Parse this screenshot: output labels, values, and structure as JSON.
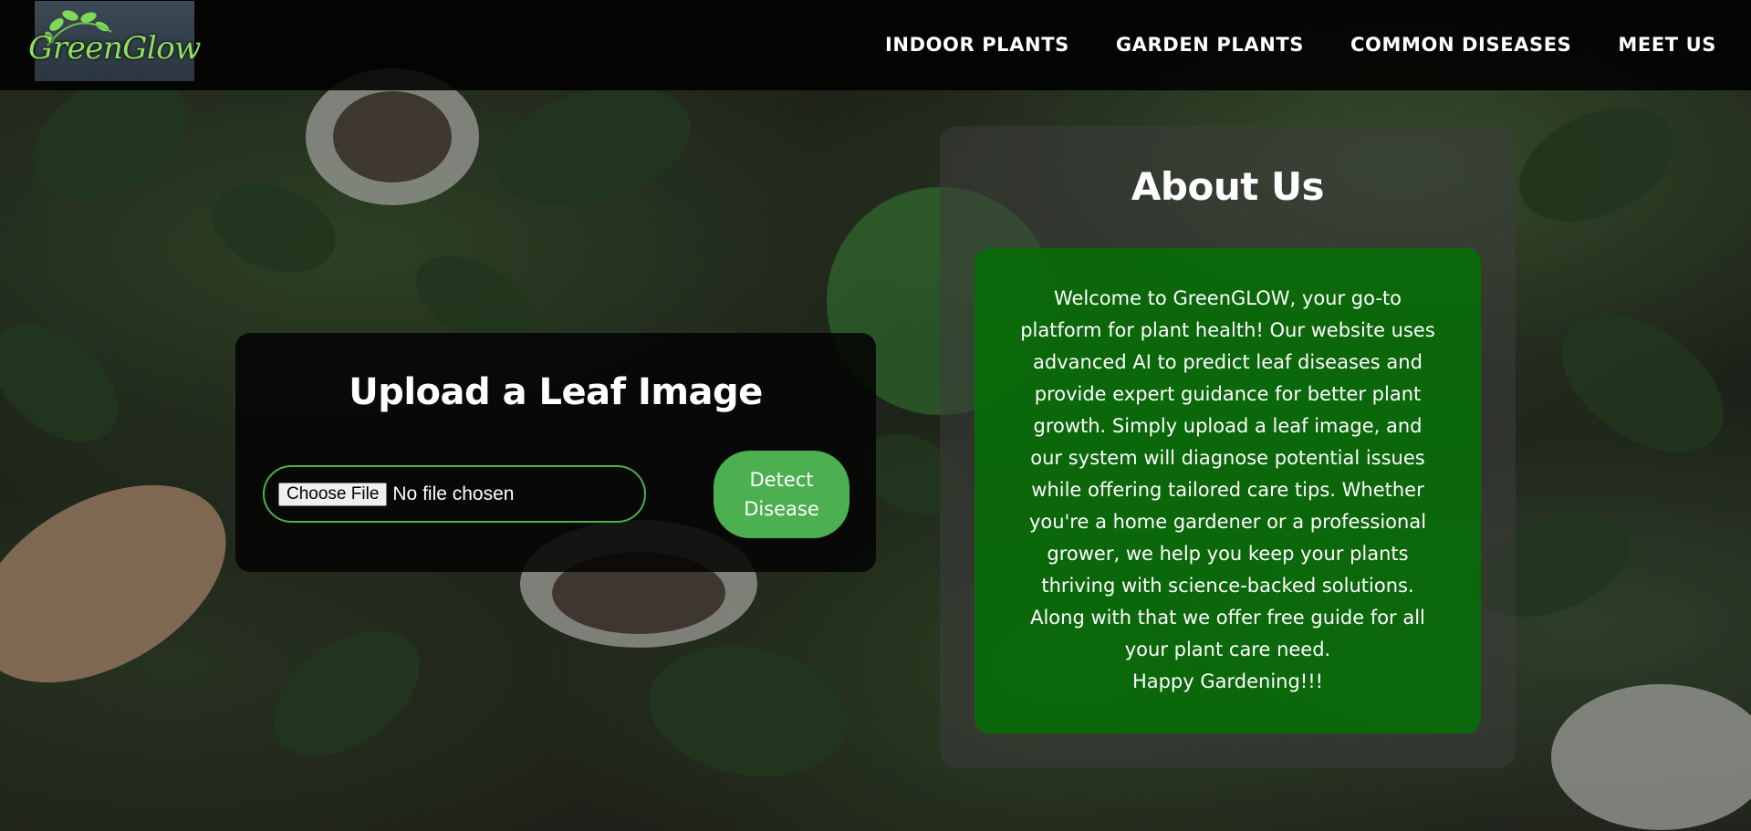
{
  "header": {
    "logo_text": "GreenGlow",
    "nav": [
      {
        "label": "INDOOR PLANTS"
      },
      {
        "label": "GARDEN PLANTS"
      },
      {
        "label": "COMMON DISEASES"
      },
      {
        "label": "MEET US"
      }
    ]
  },
  "upload": {
    "title": "Upload a Leaf Image",
    "choose_file_label": "Choose File",
    "file_status": "No file chosen",
    "detect_button": "Detect Disease"
  },
  "about": {
    "title": "About Us",
    "body": "Welcome to GreenGLOW, your go-to\nplatform for plant health! Our website uses\nadvanced AI to predict leaf diseases and\nprovide expert guidance for better plant\ngrowth. Simply upload a leaf image, and\nour system will diagnose potential issues\nwhile offering tailored care tips. Whether\nyou're a home gardener or a professional\ngrower, we help you keep your plants\nthriving with science-backed solutions.\nAlong with that we offer free guide for all\nyour plant care need.\nHappy Gardening!!!"
  },
  "colors": {
    "accent": "#4caf50",
    "about_box": "#066e06",
    "header_bg": "#000000"
  },
  "icons": {
    "logo": "leaf-logo-icon"
  }
}
